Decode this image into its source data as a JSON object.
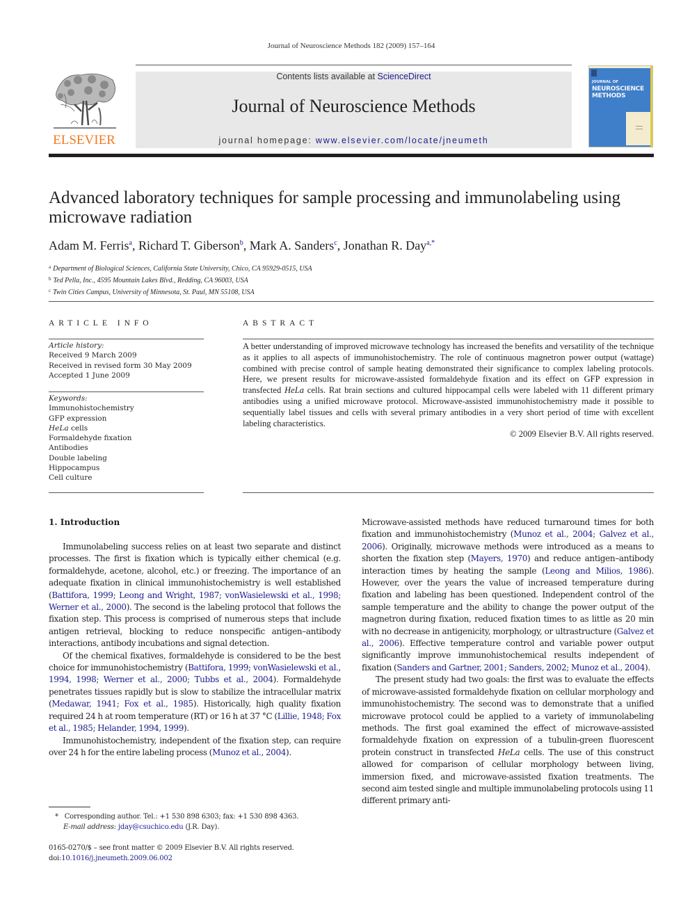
{
  "running_head": "Journal of Neuroscience Methods 182 (2009) 157–164",
  "masthead": {
    "publisher_logo_text": "ELSEVIER",
    "contents_prefix": "Contents lists available at ",
    "contents_link": "ScienceDirect",
    "journal_title": "Journal of Neuroscience Methods",
    "homepage_prefix": "journal homepage: ",
    "homepage_link": "www.elsevier.com/locate/jneumeth",
    "cover": {
      "line1": "JOURNAL OF",
      "line2": "NEUROSCIENCE",
      "line3": "METHODS",
      "color_main": "#3f7ec9",
      "color_panel": "#f3ecce"
    }
  },
  "article": {
    "title": "Advanced laboratory techniques for sample processing and immunolabeling using microwave radiation",
    "authors": [
      {
        "name": "Adam M. Ferris",
        "sup": "a"
      },
      {
        "name": "Richard T. Giberson",
        "sup": "b"
      },
      {
        "name": "Mark A. Sanders",
        "sup": "c"
      },
      {
        "name": "Jonathan R. Day",
        "sup": "a,*"
      }
    ],
    "affiliations": [
      {
        "key": "a",
        "text": "Department of Biological Sciences, California State University, Chico, CA 95929-0515, USA"
      },
      {
        "key": "b",
        "text": "Ted Pella, Inc., 4595 Mountain Lakes Blvd., Redding, CA 96003, USA"
      },
      {
        "key": "c",
        "text": "Twin Cities Campus, University of Minnesota, St. Paul, MN 55108, USA"
      }
    ]
  },
  "article_info": {
    "heading": "ARTICLE INFO",
    "history_label": "Article history:",
    "history": [
      "Received 9 March 2009",
      "Received in revised form 30 May 2009",
      "Accepted 1 June 2009"
    ],
    "keywords_label": "Keywords:",
    "keywords": [
      "Immunohistochemistry",
      "GFP expression",
      "HeLa cells",
      "Formaldehyde fixation",
      "Antibodies",
      "Double labeling",
      "Hippocampus",
      "Cell culture"
    ]
  },
  "abstract": {
    "heading": "ABSTRACT",
    "text_1": "A better understanding of improved microwave technology has increased the benefits and versatility of the technique as it applies to all aspects of immunohistochemistry. The role of continuous magnetron power output (wattage) combined with precise control of sample heating demonstrated their significance to complex labeling protocols. Here, we present results for microwave-assisted formaldehyde fixation and its effect on GFP expression in transfected ",
    "text_italic": "HeLa",
    "text_2": " cells. Rat brain sections and cultured hippocampal cells were labeled with 11 different primary antibodies using a unified microwave protocol. Microwave-assisted immunohistochemistry made it possible to sequentially label tissues and cells with several primary antibodies in a very short period of time with excellent labeling characteristics.",
    "copyright": "© 2009 Elsevier B.V. All rights reserved."
  },
  "body": {
    "section_heading": "1.  Introduction",
    "left_column": [
      {
        "parts": [
          {
            "t": "Immunolabeling success relies on at least two separate and distinct processes. The first is fixation which is typically either chemical (e.g. formaldehyde, acetone, alcohol, etc.) or freezing. The importance of an adequate fixation in clinical immunohistochemistry is well established ("
          },
          {
            "t": "Battifora, 1999; Leong and Wright, 1987; vonWasielewski et al., 1998; Werner et al., 2000",
            "link": true
          },
          {
            "t": "). The second is the labeling protocol that follows the fixation step. This process is comprised of numerous steps that include antigen retrieval, blocking to reduce nonspecific antigen–antibody interactions, antibody incubations and signal detection."
          }
        ]
      },
      {
        "parts": [
          {
            "t": "Of the chemical fixatives, formaldehyde is considered to be the best choice for immunohistochemistry ("
          },
          {
            "t": "Battifora, 1999; vonWasielewski et al., 1994, 1998; Werner et al., 2000; Tubbs et al., 2004",
            "link": true
          },
          {
            "t": "). Formaldehyde penetrates tissues rapidly but is slow to stabilize the intracellular matrix ("
          },
          {
            "t": "Medawar, 1941; Fox et al., 1985",
            "link": true
          },
          {
            "t": "). Historically, high quality fixation required 24 h at room temperature (RT) or 16 h at 37 °C ("
          },
          {
            "t": "Lillie, 1948; Fox et al., 1985; Helander, 1994, 1999",
            "link": true
          },
          {
            "t": ")."
          }
        ]
      },
      {
        "parts": [
          {
            "t": "Immunohistochemistry, independent of the fixation step, can require over 24 h for the entire labeling process ("
          },
          {
            "t": "Munoz et al., 2004",
            "link": true
          },
          {
            "t": ")."
          }
        ]
      }
    ],
    "right_column": [
      {
        "noindent": true,
        "parts": [
          {
            "t": "Microwave-assisted methods have reduced turnaround times for both fixation and immunohistochemistry ("
          },
          {
            "t": "Munoz et al., 2004; Galvez et al., 2006",
            "link": true
          },
          {
            "t": "). Originally, microwave methods were introduced as a means to shorten the fixation step ("
          },
          {
            "t": "Mayers, 1970",
            "link": true
          },
          {
            "t": ") and reduce antigen–antibody interaction times by heating the sample ("
          },
          {
            "t": "Leong and Milios, 1986",
            "link": true
          },
          {
            "t": "). However, over the years the value of increased temperature during fixation and labeling has been questioned. Independent control of the sample temperature and the ability to change the power output of the magnetron during fixation, reduced fixation times to as little as 20 min with no decrease in antigenicity, morphology, or ultrastructure ("
          },
          {
            "t": "Galvez et al., 2006",
            "link": true
          },
          {
            "t": "). Effective temperature control and variable power output significantly improve immunohistochemical results independent of fixation ("
          },
          {
            "t": "Sanders and Gartner, 2001; Sanders, 2002; Munoz et al., 2004",
            "link": true
          },
          {
            "t": ")."
          }
        ]
      },
      {
        "parts": [
          {
            "t": "The present study had two goals: the first was to evaluate the effects of microwave-assisted formaldehyde fixation on cellular morphology and immunohistochemistry. The second was to demonstrate that a unified microwave protocol could be applied to a variety of immunolabeling methods. The first goal examined the effect of microwave-assisted formaldehyde fixation on expression of a tubulin-green fluorescent protein construct in transfected "
          },
          {
            "t": "HeLa",
            "italic": true
          },
          {
            "t": " cells. The use of this construct allowed for comparison of cellular morphology between living, immersion fixed, and microwave-assisted fixation treatments. The second aim tested single and multiple immunolabeling protocols using 11 different primary anti-"
          }
        ]
      }
    ]
  },
  "footnotes": {
    "corresponding_marker": "*",
    "corresponding_text": "Corresponding author. Tel.: +1 530 898 6303; fax: +1 530 898 4363.",
    "email_label": "E-mail address:",
    "email": "jday@csuchico.edu",
    "email_suffix": " (J.R. Day).",
    "issn_line": "0165-0270/$ – see front matter © 2009 Elsevier B.V. All rights reserved.",
    "doi_prefix": "doi:",
    "doi": "10.1016/j.jneumeth.2009.06.002"
  }
}
